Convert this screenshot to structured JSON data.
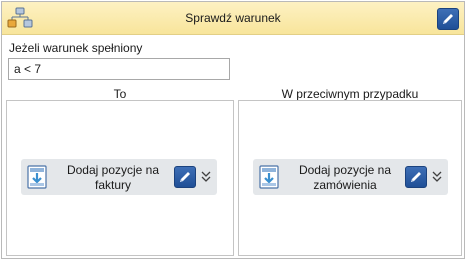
{
  "header": {
    "title": "Sprawdź warunek",
    "icon": "flow-diagram-icon",
    "edit_icon": "pencil-icon"
  },
  "condition": {
    "label": "Jeżeli warunek spełniony",
    "value": "a < 7"
  },
  "branches": [
    {
      "title": "To",
      "action": {
        "line1": "Dodaj pozycje na",
        "line2": "faktury",
        "icon": "document-download-icon",
        "edit_icon": "pencil-icon",
        "expand_icon": "double-chevron-down-icon"
      }
    },
    {
      "title": "W przeciwnym przypadku",
      "action": {
        "line1": "Dodaj pozycje na",
        "line2": "zamówienia",
        "icon": "document-download-icon",
        "edit_icon": "pencil-icon",
        "expand_icon": "double-chevron-down-icon"
      }
    }
  ],
  "colors": {
    "header_bg": "#f8e59b",
    "button_blue": "#2b5ea8",
    "action_bg": "#e4e7ea"
  }
}
